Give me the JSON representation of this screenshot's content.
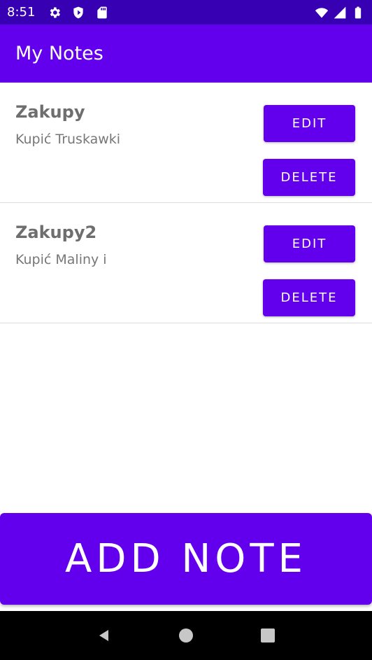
{
  "status_bar": {
    "time": "8:51",
    "left_icons": [
      "gear-icon",
      "shield-icon",
      "sd-card-icon"
    ],
    "right_icons": [
      "wifi-icon",
      "signal-icon",
      "battery-icon"
    ]
  },
  "app_bar": {
    "title": "My Notes"
  },
  "notes": [
    {
      "title": "Zakupy",
      "body": "Kupić Truskawki",
      "edit_label": "EDIT",
      "delete_label": "DELETE"
    },
    {
      "title": "Zakupy2",
      "body": "Kupić Maliny i",
      "edit_label": "EDIT",
      "delete_label": "DELETE"
    }
  ],
  "add_note_button": {
    "label": "ADD NOTE"
  },
  "nav_bar": {
    "icons": [
      "back-icon",
      "home-icon",
      "recents-icon"
    ]
  },
  "colors": {
    "primary": "#6200ee",
    "primary_dark": "#3700b3"
  }
}
